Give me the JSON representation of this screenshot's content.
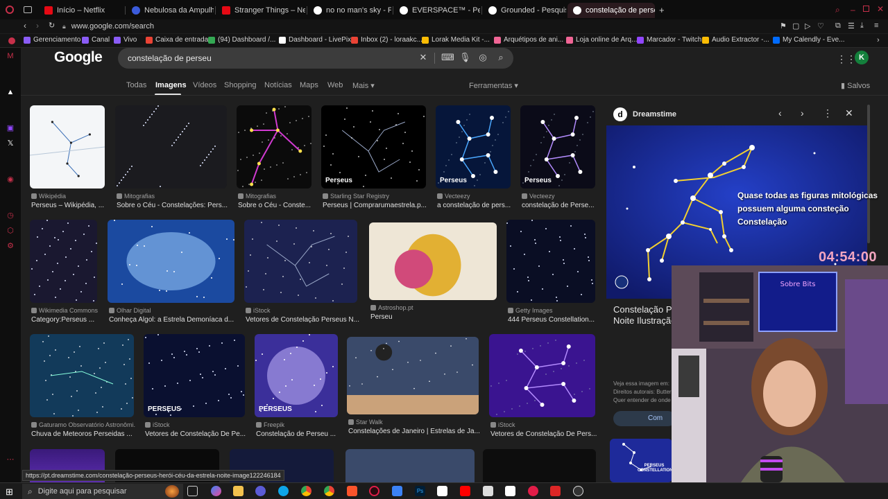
{
  "browser": {
    "tabs": [
      {
        "label": "Início – Netflix",
        "color": "#e50914"
      },
      {
        "label": "Nebulosa da Ampulheta",
        "color": "#3b5bdb"
      },
      {
        "label": "Stranger Things – Netflix",
        "color": "#e50914"
      },
      {
        "label": "no no man's sky - Pesqu",
        "color": "#ffffff"
      },
      {
        "label": "EVERSPACE™ - Pesquisa",
        "color": "#ffffff"
      },
      {
        "label": "Grounded - Pesquisa Goo",
        "color": "#ffffff"
      },
      {
        "label": "constelação de perseu - ",
        "color": "#ffffff"
      }
    ],
    "url": "www.google.com/search",
    "bookmarks": [
      {
        "label": "Gerenciamento",
        "color": "#8a5cf6"
      },
      {
        "label": "Canal",
        "color": "#8a5cf6"
      },
      {
        "label": "Vivo",
        "color": "#8a5cf6"
      },
      {
        "label": "Caixa de entrada",
        "color": "#ea4335"
      },
      {
        "label": "(94) Dashboard /...",
        "color": "#34a853"
      },
      {
        "label": "Dashboard - LivePix",
        "color": "#ffffff"
      },
      {
        "label": "Inbox (2) - loraakc...",
        "color": "#ea4335"
      },
      {
        "label": "Lorak Media Kit -...",
        "color": "#fbbc04"
      },
      {
        "label": "Arquétipos de ani...",
        "color": "#f06595"
      },
      {
        "label": "Loja online de Arq...",
        "color": "#f06595"
      },
      {
        "label": "Marcador - Twitch",
        "color": "#9146ff"
      },
      {
        "label": "Audio Extractor -...",
        "color": "#fbbc04"
      },
      {
        "label": "My Calendly - Eve...",
        "color": "#006bff"
      }
    ]
  },
  "google": {
    "logo": "Google",
    "query": "constelação de perseu",
    "nav": [
      "Todas",
      "Imagens",
      "Vídeos",
      "Shopping",
      "Notícias",
      "Maps",
      "Web",
      "Mais"
    ],
    "tools": "Ferramentas",
    "saved": "Salvos",
    "avatar_letter": "K"
  },
  "results": [
    {
      "source": "Wikipédia",
      "title": "Perseus – Wikipédia, ..."
    },
    {
      "source": "Mitografias",
      "title": "Sobre o Céu - Constelações: Pers..."
    },
    {
      "source": "Mitografias",
      "title": "Sobre o Céu - Conste..."
    },
    {
      "source": "Starling Star Registry",
      "title": "Perseus | Comprarumaestrela.p..."
    },
    {
      "source": "Vecteezy",
      "title": "a constelação de pers..."
    },
    {
      "source": "Vecteezy",
      "title": "constelação de Perse..."
    },
    {
      "source": "Wikimedia Commons",
      "title": "Category:Perseus ..."
    },
    {
      "source": "Olhar Digital",
      "title": "Conheça Algol: a Estrela Demoníaca d..."
    },
    {
      "source": "iStock",
      "title": "Vetores de Constelação Perseus N..."
    },
    {
      "source": "Astroshop.pt",
      "title": "Perseu"
    },
    {
      "source": "Getty Images",
      "title": "444 Perseus Constellation..."
    },
    {
      "source": "Gaturamo Observatório Astronômi...",
      "title": "Chuva de Meteoros Perseidas ..."
    },
    {
      "source": "iStock",
      "title": "Vetores de Constelação De Pe..."
    },
    {
      "source": "Freepik",
      "title": "Constelação de Perseu ..."
    },
    {
      "source": "Star Walk",
      "title": "Constelações de Janeiro | Estrelas de Ja..."
    },
    {
      "source": "iStock",
      "title": "Vetores de Constelação De Pers..."
    }
  ],
  "thumb_labels": {
    "perseus_a": "Perseus",
    "perseus_b": "Perseus",
    "perseus_c": "Perseus",
    "perseus_d": "PERSEUS",
    "perseus_e": "PERSEUS",
    "perseus_f": "PERSEUS"
  },
  "panel": {
    "source": "Dreamstime",
    "title": "Constelação Pe Noite Ilustração",
    "line1": "Veja essa imagem em:",
    "line2": "Direitos autorais: Butter",
    "line3": "Quer entender de onde",
    "button": "Com",
    "thumb_caption": "PERSEUS CONSTELLATION"
  },
  "stream_overlay": {
    "caption": "Quase todas as figuras mitológicas possuem alguma consteção Constelação",
    "timer": "04:54:00",
    "neon_sign": "Sobre Bits"
  },
  "status_url": "https://pt.dreamstime.com/constelação-perseus-herói-céu-da-estrela-noite-image122246184",
  "taskbar": {
    "search_placeholder": "Digite aqui para pesquisar"
  }
}
